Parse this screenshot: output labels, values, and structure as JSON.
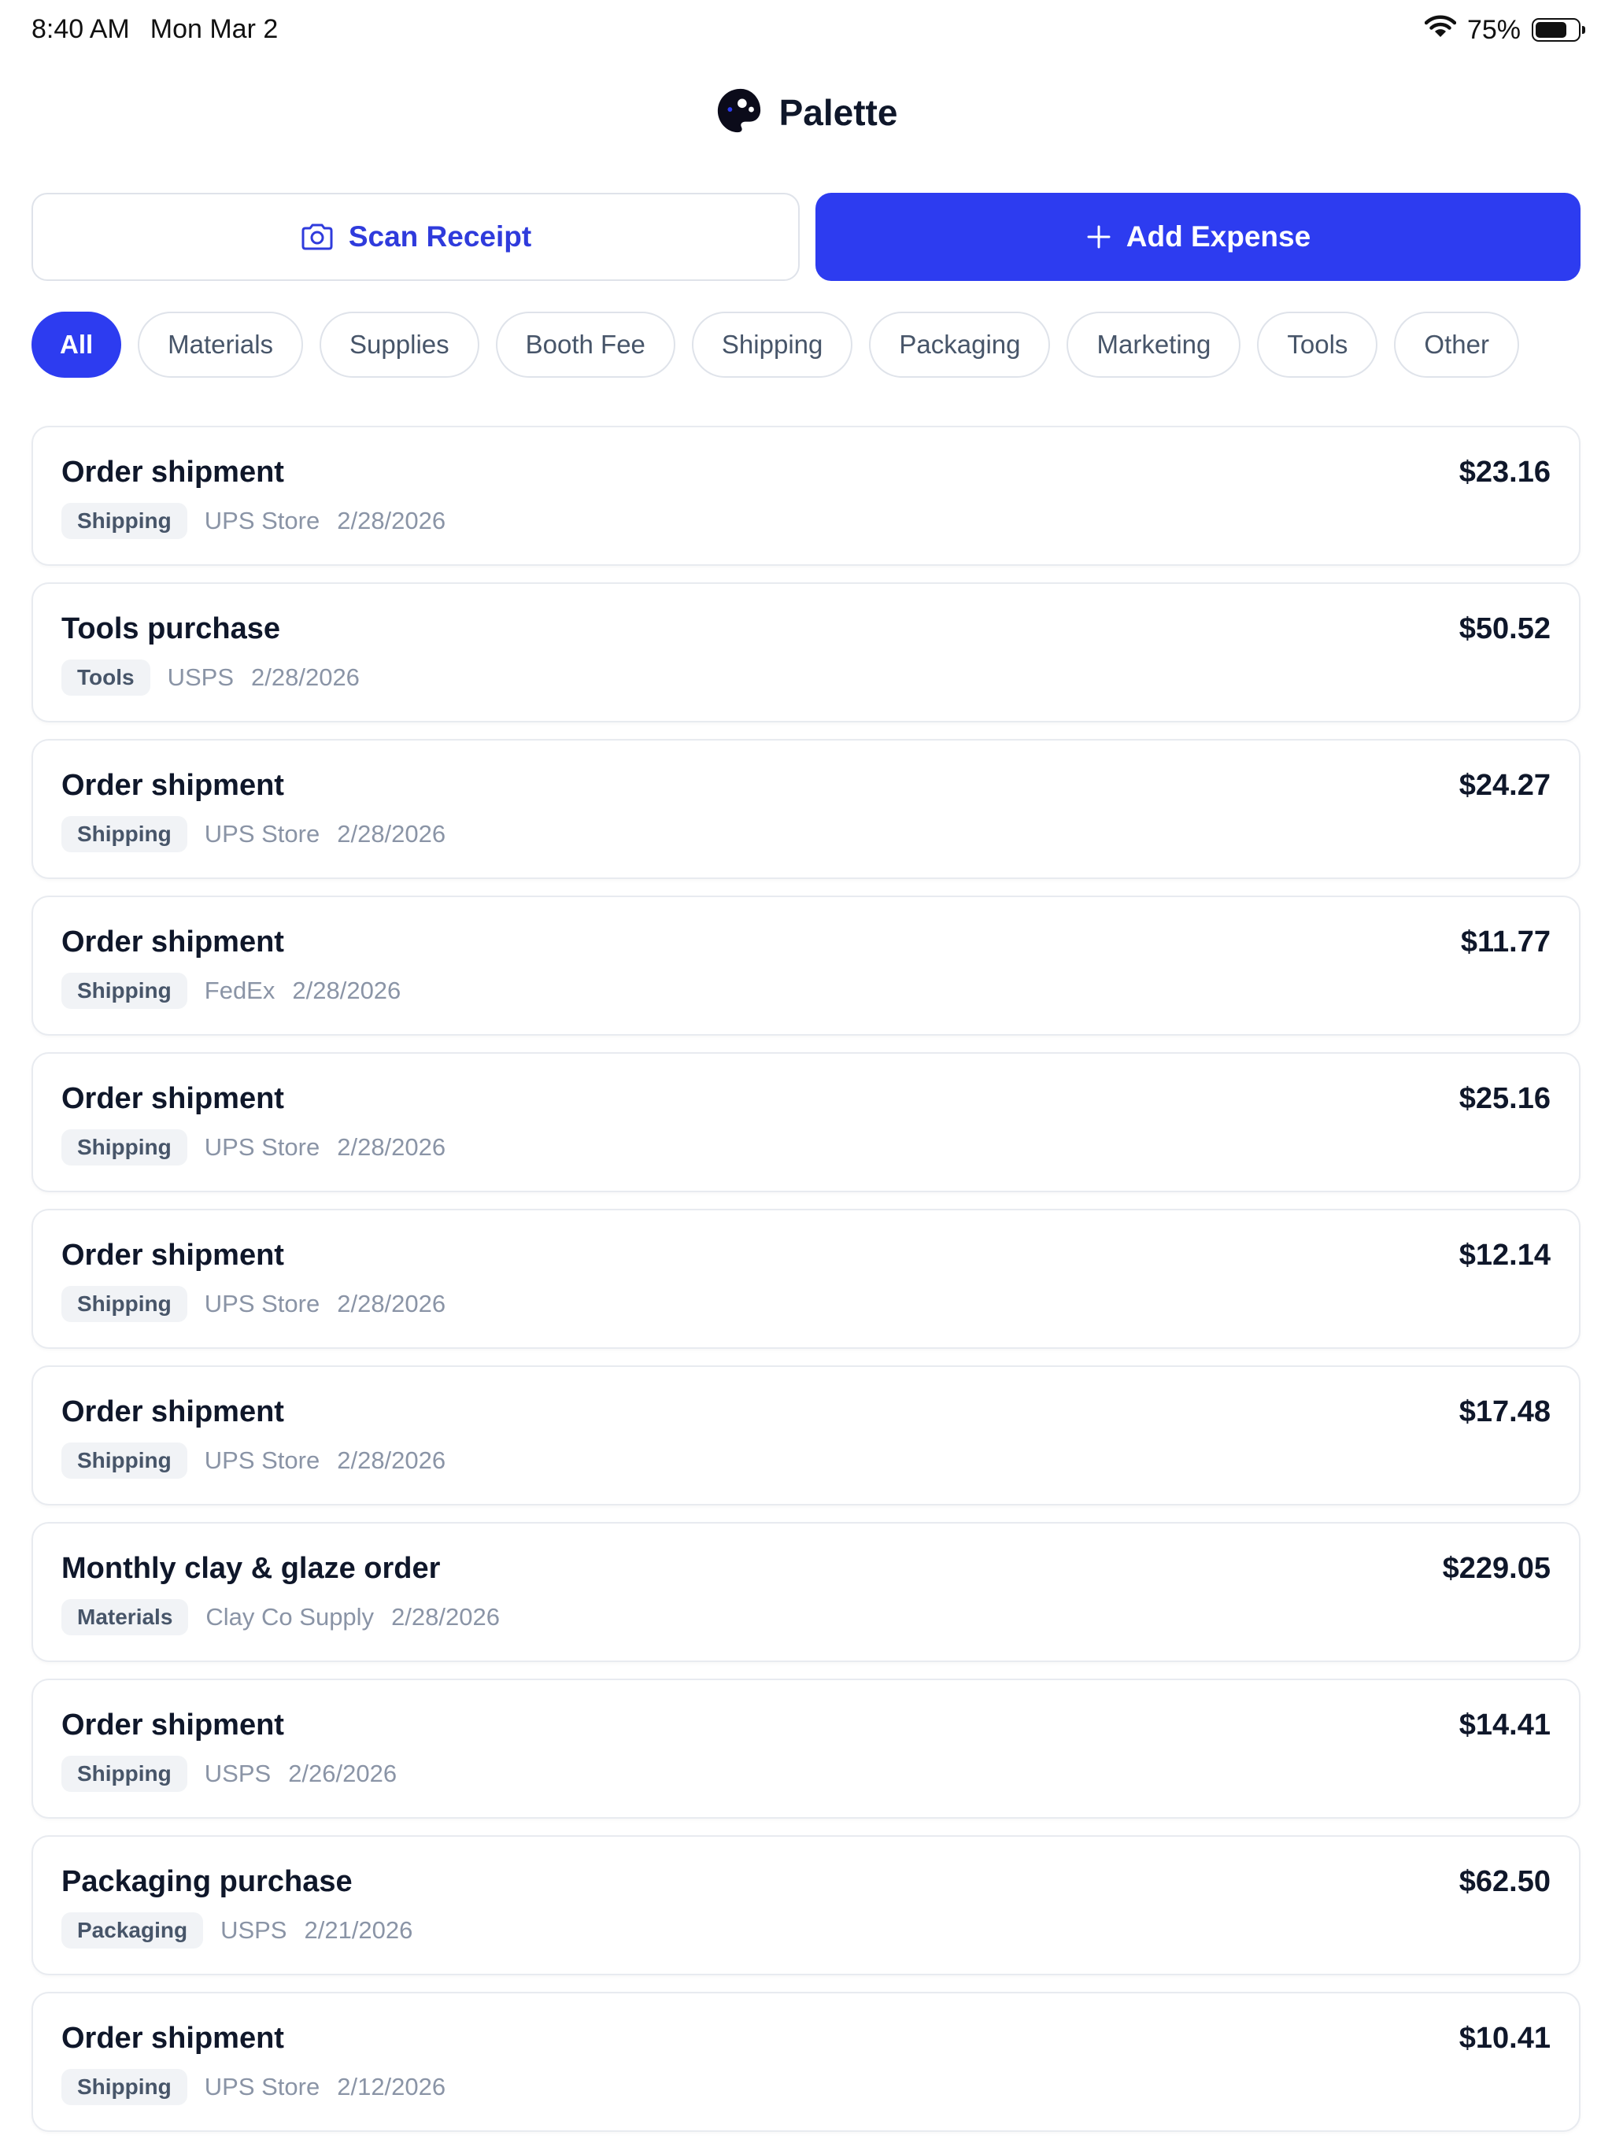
{
  "status_bar": {
    "time": "8:40 AM",
    "date": "Mon Mar 2",
    "battery_percent": "75%",
    "battery_level": 0.75,
    "icons": [
      "wifi-icon",
      "battery-icon"
    ]
  },
  "header": {
    "title": "Palette",
    "logo_icon": "palette-icon"
  },
  "actions": {
    "scan_label": "Scan Receipt",
    "scan_icon": "camera-icon",
    "add_label": "Add Expense",
    "add_icon": "plus-icon"
  },
  "colors": {
    "accent": "#2d3cf0",
    "scan_text": "#2f3bdc",
    "text_primary": "#0f172a",
    "text_muted": "#8a94a6"
  },
  "filters": {
    "selected": "All",
    "items": [
      "All",
      "Materials",
      "Supplies",
      "Booth Fee",
      "Shipping",
      "Packaging",
      "Marketing",
      "Tools",
      "Other"
    ]
  },
  "expenses": [
    {
      "title": "Order shipment",
      "category": "Shipping",
      "vendor": "UPS Store",
      "date": "2/28/2026",
      "amount": "$23.16"
    },
    {
      "title": "Tools purchase",
      "category": "Tools",
      "vendor": "USPS",
      "date": "2/28/2026",
      "amount": "$50.52"
    },
    {
      "title": "Order shipment",
      "category": "Shipping",
      "vendor": "UPS Store",
      "date": "2/28/2026",
      "amount": "$24.27"
    },
    {
      "title": "Order shipment",
      "category": "Shipping",
      "vendor": "FedEx",
      "date": "2/28/2026",
      "amount": "$11.77"
    },
    {
      "title": "Order shipment",
      "category": "Shipping",
      "vendor": "UPS Store",
      "date": "2/28/2026",
      "amount": "$25.16"
    },
    {
      "title": "Order shipment",
      "category": "Shipping",
      "vendor": "UPS Store",
      "date": "2/28/2026",
      "amount": "$12.14"
    },
    {
      "title": "Order shipment",
      "category": "Shipping",
      "vendor": "UPS Store",
      "date": "2/28/2026",
      "amount": "$17.48"
    },
    {
      "title": "Monthly clay & glaze order",
      "category": "Materials",
      "vendor": "Clay Co Supply",
      "date": "2/28/2026",
      "amount": "$229.05"
    },
    {
      "title": "Order shipment",
      "category": "Shipping",
      "vendor": "USPS",
      "date": "2/26/2026",
      "amount": "$14.41"
    },
    {
      "title": "Packaging purchase",
      "category": "Packaging",
      "vendor": "USPS",
      "date": "2/21/2026",
      "amount": "$62.50"
    },
    {
      "title": "Order shipment",
      "category": "Shipping",
      "vendor": "UPS Store",
      "date": "2/12/2026",
      "amount": "$10.41"
    }
  ]
}
